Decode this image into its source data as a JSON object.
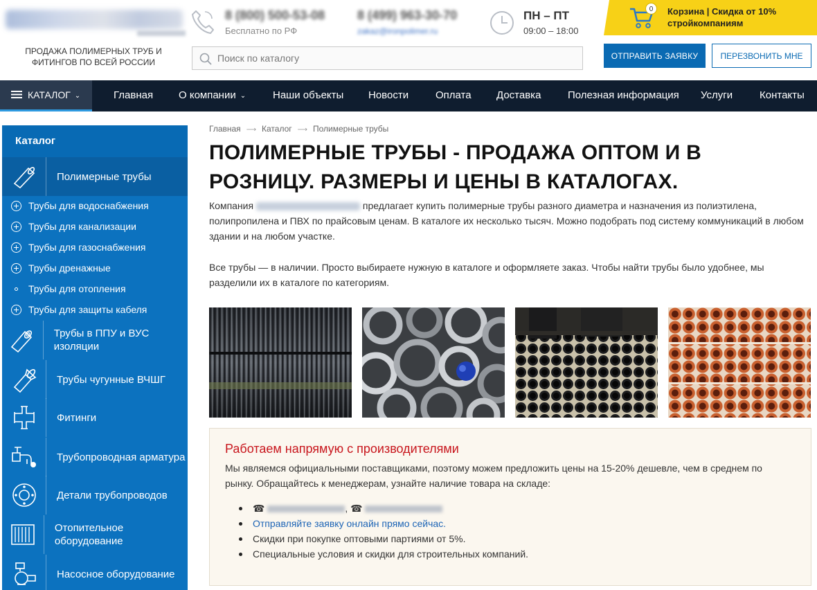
{
  "header": {
    "tagline": "ПРОДАЖА ПОЛИМЕРНЫХ ТРУБ И ФИТИНГОВ ПО ВСЕЙ РОССИИ",
    "phone_main": "8 (800) 500-53-08",
    "phone_main_sub": "Бесплатно по РФ",
    "phone_second": "8 (499) 963-30-70",
    "email": "zakaz@ironpolimer.ru",
    "hours_days": "ПН – ПТ",
    "hours_time": "09:00 – 18:00",
    "cart_count": "0",
    "cart_text": "Корзина | Скидка от 10% стройкомпаниям",
    "search_placeholder": "Поиск по каталогу",
    "order_button": "ОТПРАВИТЬ ЗАЯВКУ",
    "call_button": "ПЕРЕЗВОНИТЬ МНЕ"
  },
  "nav": {
    "catalog": "КАТАЛОГ",
    "items": [
      "Главная",
      "О компании",
      "Наши объекты",
      "Новости",
      "Оплата",
      "Доставка",
      "Полезная информация",
      "Услуги",
      "Контакты"
    ]
  },
  "sidebar": {
    "title": "Каталог",
    "active": "Полимерные трубы",
    "subitems": [
      "Трубы для водоснабжения",
      "Трубы для канализации",
      "Трубы для газоснабжения",
      "Трубы дренажные",
      "Трубы для отопления",
      "Трубы для защиты кабеля"
    ],
    "items": [
      "Трубы в ППУ и ВУС изоляции",
      "Трубы чугунные ВЧШГ",
      "Фитинги",
      "Трубопроводная арматура",
      "Детали трубопроводов",
      "Отопительное оборудование",
      "Насосное оборудование"
    ]
  },
  "breadcrumb": [
    "Главная",
    "Каталог",
    "Полимерные трубы"
  ],
  "main": {
    "title": "ПОЛИМЕРНЫЕ ТРУБЫ - ПРОДАЖА ОПТОМ И В РОЗНИЦУ. РАЗМЕРЫ И ЦЕНЫ В КАТАЛОГАХ.",
    "p1_before": "Компания ",
    "p1_after": " предлагает купить полимерные трубы разного диаметра и назначения из полиэтилена, полипропилена и ПВХ по прайсовым ценам. В каталоге их несколько тысяч. Можно подобрать под систему коммуникаций в любом здании и на любом участке.",
    "p2": "Все трубы — в наличии. Просто выбираете нужную в каталоге и оформляете заказ. Чтобы найти трубы было удобнее, мы разделили их в каталоге по категориям."
  },
  "infobox": {
    "title": "Работаем напрямую с производителями",
    "text": "Мы являемся официальными поставщиками, поэтому можем предложить цены на 15-20% дешевле, чем в среднем по рынку. Обращайтесь к менеджерам, узнайте наличие товара на складе:",
    "phone_icon": "☎",
    "separator": ",",
    "link": "Отправляйте заявку онлайн прямо сейчас.",
    "item3": "Скидки при покупке оптовыми партиями от 5%.",
    "item4": "Специальные условия и скидки для строительных компаний."
  },
  "colors": {
    "sidebar": "#0c72bf",
    "nav": "#0f1d2f",
    "cart": "#f7d117",
    "accent_red": "#c8161d",
    "button_blue": "#0a6ab3"
  }
}
